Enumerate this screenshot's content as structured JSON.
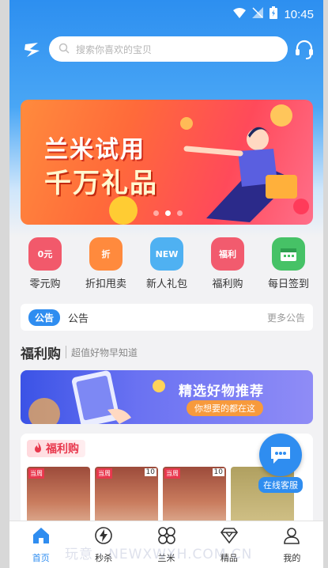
{
  "status_bar": {
    "time": "10:45"
  },
  "header": {
    "search_placeholder": "搜索你喜欢的宝贝"
  },
  "banner": {
    "line1": "兰米试用",
    "line2": "千万礼品",
    "slide_count": 3,
    "active_slide": 2
  },
  "quick_icons": [
    {
      "label": "零元购",
      "badge": "0元",
      "color": "#f2596b"
    },
    {
      "label": "折扣甩卖",
      "badge": "折",
      "color": "#ff8a3d"
    },
    {
      "label": "新人礼包",
      "badge": "NEW",
      "color": "#4fb1f2"
    },
    {
      "label": "福利购",
      "badge": "福利",
      "color": "#f25b6e"
    },
    {
      "label": "每日签到",
      "badge": "",
      "color": "#46c266"
    }
  ],
  "notice": {
    "tag": "公告",
    "text": "公告",
    "more": "更多公告"
  },
  "section": {
    "title": "福利购",
    "subtitle": "超值好物早知道"
  },
  "promo": {
    "title": "精选好物推荐",
    "subtitle": "你想要的都在这"
  },
  "fuli_card": {
    "header_label": "福利购",
    "products": [
      {
        "badge": "当周",
        "count": ""
      },
      {
        "badge": "当周",
        "count": "10"
      },
      {
        "badge": "当周",
        "count": "10"
      },
      {
        "badge": "",
        "count": ""
      }
    ]
  },
  "float_cs": {
    "label": "在线客服"
  },
  "tabbar": [
    {
      "label": "首页",
      "icon": "home-icon",
      "active": true
    },
    {
      "label": "秒杀",
      "icon": "lightning-icon",
      "active": false
    },
    {
      "label": "兰米",
      "icon": "clover-icon",
      "active": false
    },
    {
      "label": "精品",
      "icon": "gem-icon",
      "active": false
    },
    {
      "label": "我的",
      "icon": "user-icon",
      "active": false
    }
  ],
  "watermark": "玩意 · NEWXWXH.COM.CN"
}
